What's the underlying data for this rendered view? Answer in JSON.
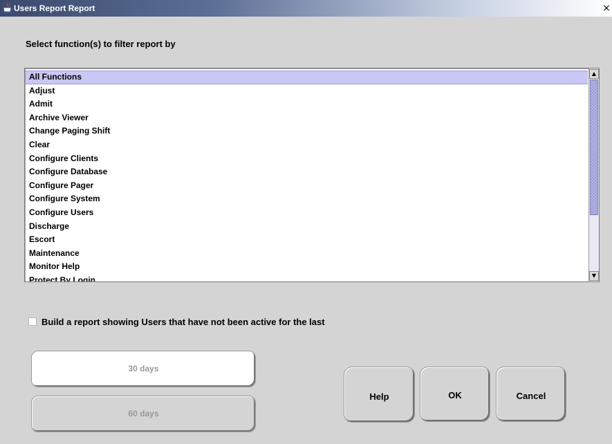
{
  "window": {
    "title": "Users Report Report",
    "close_glyph": "×"
  },
  "heading": "Select function(s) to filter report by",
  "function_list": {
    "selected_index": 0,
    "items": [
      "All Functions",
      "Adjust",
      "Admit",
      "Archive Viewer",
      "Change Paging Shift",
      "Clear",
      "Configure Clients",
      "Configure Database",
      "Configure Pager",
      "Configure System",
      "Configure Users",
      "Discharge",
      "Escort",
      "Maintenance",
      "Monitor Help",
      "Protect By Login"
    ]
  },
  "inactive_filter": {
    "checked": false,
    "label": "Build a report showing Users that have not been active for the last"
  },
  "day_options": [
    {
      "label": "30 days"
    },
    {
      "label": "60 days"
    }
  ],
  "actions": {
    "help_label": "Help",
    "ok_label": "OK",
    "cancel_label": "Cancel"
  },
  "icons": {
    "app": "java-cup-icon",
    "close": "close-icon",
    "scroll_up": "scroll-up-arrow-icon",
    "scroll_down": "scroll-down-arrow-icon"
  },
  "colors": {
    "titlebar_start": "#3a4a6e",
    "selection": "#c9c7f3",
    "window_bg": "#d4d4d4",
    "scroll_thumb": "#b9b9e6"
  }
}
